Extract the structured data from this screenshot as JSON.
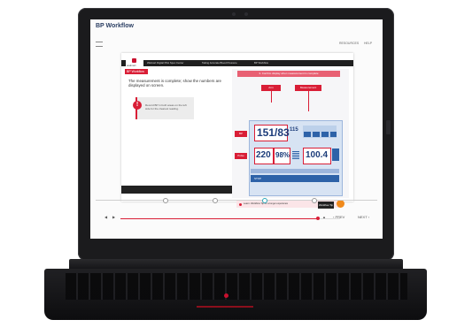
{
  "app": {
    "title": "BP Workflow"
  },
  "header_menu": {
    "resources": "RESOURCES",
    "help": "HELP"
  },
  "slide": {
    "logo_text": "walmart",
    "breadcrumbs": [
      "Walmart Digital Pilot Spec Center",
      "Taking Accurate Blood Pressure",
      "BP Workflow"
    ],
    "section_tab": "BP Workflow",
    "instruction": "The measurement is complete; show the numbers are displayed on screen.",
    "tip_text": "Record BP in both areas on the left side for the clearest reading.",
    "banner": "3. Confirm display when measurement is complete",
    "label_a": "Arm",
    "label_b": "Measurement",
    "side_tab_bp": "BP",
    "side_tab_pulse": "Pulse",
    "reading_main": "151/83",
    "reading_map": "115",
    "reading_left": "220",
    "reading_pct": "98%",
    "reading_right": "100.4",
    "mode_label": "STOP",
    "note_text": "Learn: Workflow Tip for a longer experience",
    "workflow_button": "Workflow Tip"
  },
  "player": {
    "prev": "PREV",
    "next": "NEXT"
  },
  "colors": {
    "accent": "#d91e36",
    "monitor": "#d7e3f3",
    "title": "#2b3f63"
  },
  "icons": [
    "menu-icon",
    "info-icon",
    "rewind-icon",
    "play-icon",
    "volume-icon",
    "location-pin-icon"
  ]
}
